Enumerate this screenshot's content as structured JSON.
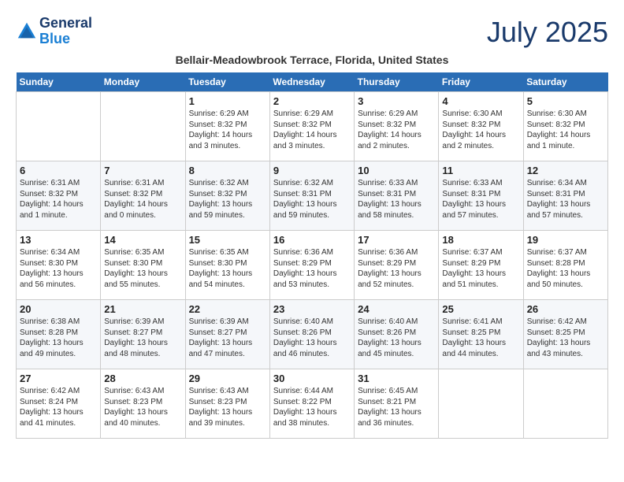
{
  "header": {
    "logo_line1": "General",
    "logo_line2": "Blue",
    "month": "July 2025",
    "location": "Bellair-Meadowbrook Terrace, Florida, United States"
  },
  "weekdays": [
    "Sunday",
    "Monday",
    "Tuesday",
    "Wednesday",
    "Thursday",
    "Friday",
    "Saturday"
  ],
  "weeks": [
    [
      {
        "day": "",
        "sunrise": "",
        "sunset": "",
        "daylight": ""
      },
      {
        "day": "",
        "sunrise": "",
        "sunset": "",
        "daylight": ""
      },
      {
        "day": "1",
        "sunrise": "Sunrise: 6:29 AM",
        "sunset": "Sunset: 8:32 PM",
        "daylight": "Daylight: 14 hours and 3 minutes."
      },
      {
        "day": "2",
        "sunrise": "Sunrise: 6:29 AM",
        "sunset": "Sunset: 8:32 PM",
        "daylight": "Daylight: 14 hours and 3 minutes."
      },
      {
        "day": "3",
        "sunrise": "Sunrise: 6:29 AM",
        "sunset": "Sunset: 8:32 PM",
        "daylight": "Daylight: 14 hours and 2 minutes."
      },
      {
        "day": "4",
        "sunrise": "Sunrise: 6:30 AM",
        "sunset": "Sunset: 8:32 PM",
        "daylight": "Daylight: 14 hours and 2 minutes."
      },
      {
        "day": "5",
        "sunrise": "Sunrise: 6:30 AM",
        "sunset": "Sunset: 8:32 PM",
        "daylight": "Daylight: 14 hours and 1 minute."
      }
    ],
    [
      {
        "day": "6",
        "sunrise": "Sunrise: 6:31 AM",
        "sunset": "Sunset: 8:32 PM",
        "daylight": "Daylight: 14 hours and 1 minute."
      },
      {
        "day": "7",
        "sunrise": "Sunrise: 6:31 AM",
        "sunset": "Sunset: 8:32 PM",
        "daylight": "Daylight: 14 hours and 0 minutes."
      },
      {
        "day": "8",
        "sunrise": "Sunrise: 6:32 AM",
        "sunset": "Sunset: 8:32 PM",
        "daylight": "Daylight: 13 hours and 59 minutes."
      },
      {
        "day": "9",
        "sunrise": "Sunrise: 6:32 AM",
        "sunset": "Sunset: 8:31 PM",
        "daylight": "Daylight: 13 hours and 59 minutes."
      },
      {
        "day": "10",
        "sunrise": "Sunrise: 6:33 AM",
        "sunset": "Sunset: 8:31 PM",
        "daylight": "Daylight: 13 hours and 58 minutes."
      },
      {
        "day": "11",
        "sunrise": "Sunrise: 6:33 AM",
        "sunset": "Sunset: 8:31 PM",
        "daylight": "Daylight: 13 hours and 57 minutes."
      },
      {
        "day": "12",
        "sunrise": "Sunrise: 6:34 AM",
        "sunset": "Sunset: 8:31 PM",
        "daylight": "Daylight: 13 hours and 57 minutes."
      }
    ],
    [
      {
        "day": "13",
        "sunrise": "Sunrise: 6:34 AM",
        "sunset": "Sunset: 8:30 PM",
        "daylight": "Daylight: 13 hours and 56 minutes."
      },
      {
        "day": "14",
        "sunrise": "Sunrise: 6:35 AM",
        "sunset": "Sunset: 8:30 PM",
        "daylight": "Daylight: 13 hours and 55 minutes."
      },
      {
        "day": "15",
        "sunrise": "Sunrise: 6:35 AM",
        "sunset": "Sunset: 8:30 PM",
        "daylight": "Daylight: 13 hours and 54 minutes."
      },
      {
        "day": "16",
        "sunrise": "Sunrise: 6:36 AM",
        "sunset": "Sunset: 8:29 PM",
        "daylight": "Daylight: 13 hours and 53 minutes."
      },
      {
        "day": "17",
        "sunrise": "Sunrise: 6:36 AM",
        "sunset": "Sunset: 8:29 PM",
        "daylight": "Daylight: 13 hours and 52 minutes."
      },
      {
        "day": "18",
        "sunrise": "Sunrise: 6:37 AM",
        "sunset": "Sunset: 8:29 PM",
        "daylight": "Daylight: 13 hours and 51 minutes."
      },
      {
        "day": "19",
        "sunrise": "Sunrise: 6:37 AM",
        "sunset": "Sunset: 8:28 PM",
        "daylight": "Daylight: 13 hours and 50 minutes."
      }
    ],
    [
      {
        "day": "20",
        "sunrise": "Sunrise: 6:38 AM",
        "sunset": "Sunset: 8:28 PM",
        "daylight": "Daylight: 13 hours and 49 minutes."
      },
      {
        "day": "21",
        "sunrise": "Sunrise: 6:39 AM",
        "sunset": "Sunset: 8:27 PM",
        "daylight": "Daylight: 13 hours and 48 minutes."
      },
      {
        "day": "22",
        "sunrise": "Sunrise: 6:39 AM",
        "sunset": "Sunset: 8:27 PM",
        "daylight": "Daylight: 13 hours and 47 minutes."
      },
      {
        "day": "23",
        "sunrise": "Sunrise: 6:40 AM",
        "sunset": "Sunset: 8:26 PM",
        "daylight": "Daylight: 13 hours and 46 minutes."
      },
      {
        "day": "24",
        "sunrise": "Sunrise: 6:40 AM",
        "sunset": "Sunset: 8:26 PM",
        "daylight": "Daylight: 13 hours and 45 minutes."
      },
      {
        "day": "25",
        "sunrise": "Sunrise: 6:41 AM",
        "sunset": "Sunset: 8:25 PM",
        "daylight": "Daylight: 13 hours and 44 minutes."
      },
      {
        "day": "26",
        "sunrise": "Sunrise: 6:42 AM",
        "sunset": "Sunset: 8:25 PM",
        "daylight": "Daylight: 13 hours and 43 minutes."
      }
    ],
    [
      {
        "day": "27",
        "sunrise": "Sunrise: 6:42 AM",
        "sunset": "Sunset: 8:24 PM",
        "daylight": "Daylight: 13 hours and 41 minutes."
      },
      {
        "day": "28",
        "sunrise": "Sunrise: 6:43 AM",
        "sunset": "Sunset: 8:23 PM",
        "daylight": "Daylight: 13 hours and 40 minutes."
      },
      {
        "day": "29",
        "sunrise": "Sunrise: 6:43 AM",
        "sunset": "Sunset: 8:23 PM",
        "daylight": "Daylight: 13 hours and 39 minutes."
      },
      {
        "day": "30",
        "sunrise": "Sunrise: 6:44 AM",
        "sunset": "Sunset: 8:22 PM",
        "daylight": "Daylight: 13 hours and 38 minutes."
      },
      {
        "day": "31",
        "sunrise": "Sunrise: 6:45 AM",
        "sunset": "Sunset: 8:21 PM",
        "daylight": "Daylight: 13 hours and 36 minutes."
      },
      {
        "day": "",
        "sunrise": "",
        "sunset": "",
        "daylight": ""
      },
      {
        "day": "",
        "sunrise": "",
        "sunset": "",
        "daylight": ""
      }
    ]
  ]
}
